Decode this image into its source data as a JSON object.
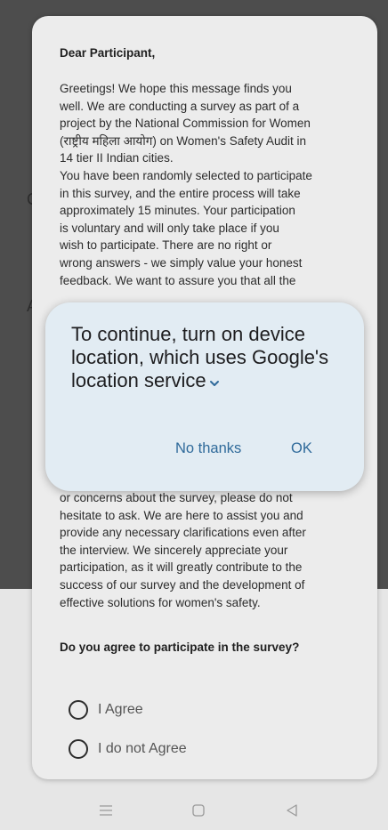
{
  "background": {
    "glimpse_letters": [
      "C",
      "A"
    ]
  },
  "consent": {
    "greeting": "Dear Participant,",
    "paragraph1_lines": [
      "Greetings! We hope this message finds you",
      "well. We are conducting a survey as part of a",
      "project by the National Commission for Women",
      "(राष्ट्रीय महिला आयोग) on Women's Safety Audit in",
      "14 tier II Indian cities.",
      "You have been randomly selected to participate",
      "in this survey, and the entire process will take",
      "approximately 15 minutes. Your participation",
      "is voluntary and will only take place if you",
      "wish to participate. There are no right or",
      "wrong answers - we simply value your honest",
      "feedback. We want to assure you that all the"
    ],
    "paragraph2_lines": [
      "or concerns about the survey, please do not",
      "hesitate to ask. We are here to assist you and",
      "provide any necessary clarifications even after",
      "the interview. We sincerely appreciate your",
      "participation, as it will greatly contribute to the",
      "success of our survey and the development of",
      "effective solutions for women's safety."
    ],
    "question": "Do you agree to participate in the survey?",
    "options": [
      "I Agree",
      "I do not Agree"
    ]
  },
  "dialog": {
    "title_lines": [
      "To continue, turn on device",
      "location, which uses Google's",
      "location service"
    ],
    "expand_icon": "chevron-down-icon",
    "no_thanks_label": "No thanks",
    "ok_label": "OK",
    "accent_color": "#2f6a9a",
    "background_color": "#e2ecf3"
  },
  "nav": {
    "icons": [
      "menu-icon",
      "home-icon",
      "back-icon"
    ]
  }
}
